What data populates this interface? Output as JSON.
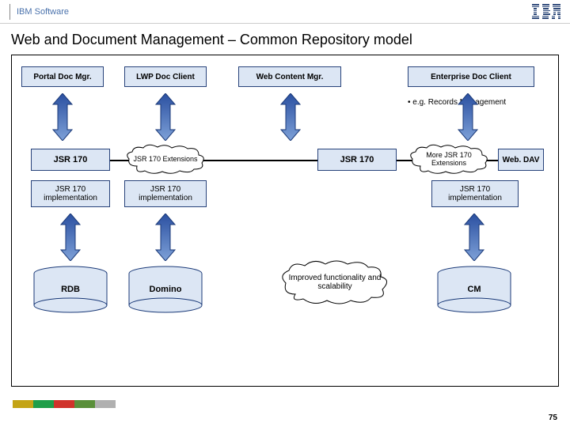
{
  "header": {
    "brand": "IBM Software",
    "logo_label": "IBM"
  },
  "title": "Web and Document Management – Common Repository model",
  "top_boxes": [
    "Portal Doc Mgr.",
    "LWP Doc Client",
    "Web Content Mgr.",
    "Enterprise Doc Client"
  ],
  "sub_note": "• e.g. Records Management",
  "row2": {
    "b1": "JSR 170",
    "c1": "JSR 170 Extensions",
    "b2": "JSR 170",
    "c2": "More JSR 170 Extensions",
    "b3": "Web. DAV"
  },
  "row3": [
    "JSR 170 implementation",
    "JSR 170 implementation",
    "JSR 170 implementation"
  ],
  "cloud_mid": "Improved functionality and scalability",
  "cylinders": [
    "RDB",
    "Domino",
    "CM"
  ],
  "page_number": "75"
}
